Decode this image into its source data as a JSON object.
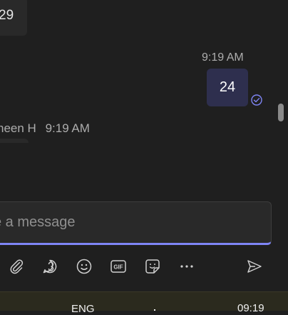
{
  "messages": {
    "incoming_top": {
      "text": "29"
    },
    "outgoing": {
      "time": "9:19 AM",
      "text": "24"
    },
    "incoming": {
      "sender_partial": "heen H",
      "time": "9:19 AM"
    }
  },
  "compose": {
    "placeholder": "e a message",
    "value": ""
  },
  "toolbar": {
    "icons": [
      "attach-icon",
      "loop-icon",
      "emoji-icon",
      "gif-icon",
      "sticker-icon",
      "more-icon",
      "send-icon"
    ],
    "gif_label": "GIF"
  },
  "taskbar": {
    "language": "ENG",
    "clock": "09:19"
  },
  "colors": {
    "accent": "#7f85f5",
    "outgoing_bubble": "#2e2f4e",
    "background": "#1f1f1f"
  }
}
